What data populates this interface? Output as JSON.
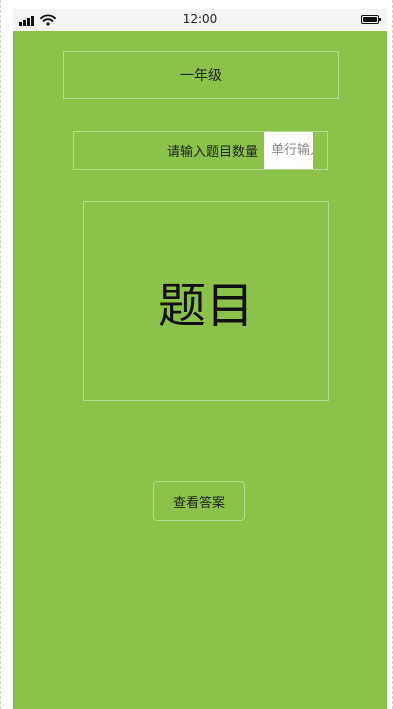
{
  "status_bar": {
    "time": "12:00",
    "signal_icon": "cellular-signal-icon",
    "wifi_icon": "wifi-icon",
    "battery_icon": "battery-icon",
    "battery_level": 1.0
  },
  "header": {
    "grade_label": "一年级"
  },
  "question_count": {
    "label": "请输入题目数量",
    "value": "",
    "placeholder": "单行输入"
  },
  "question": {
    "text": "题目"
  },
  "actions": {
    "view_answer_label": "查看答案"
  },
  "colors": {
    "screen_background": "#8bc34a",
    "border": "#b5d98f",
    "status_bar_background": "#f4f4f4"
  }
}
